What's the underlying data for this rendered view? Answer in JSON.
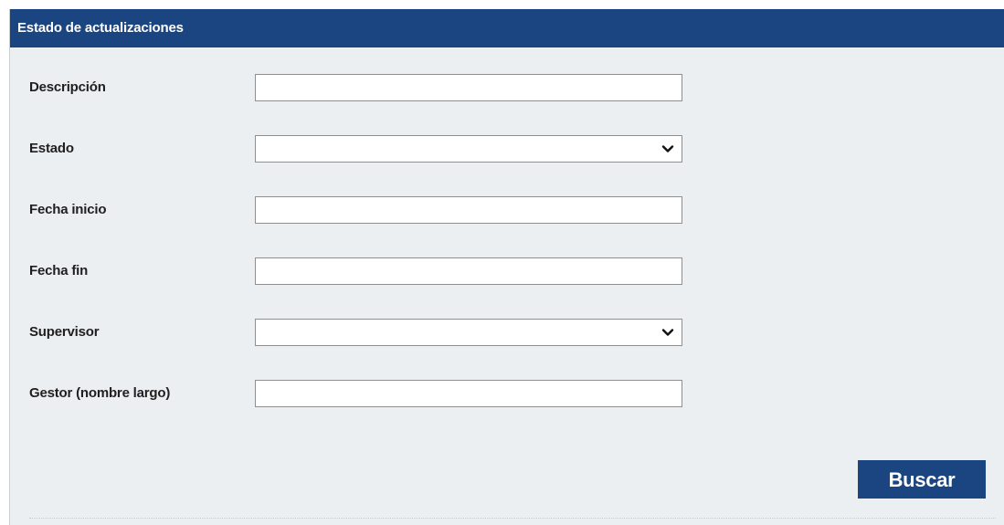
{
  "panel": {
    "title": "Estado de actualizaciones"
  },
  "form": {
    "descripcion": {
      "label": "Descripción",
      "value": "",
      "placeholder": ""
    },
    "estado": {
      "label": "Estado",
      "selected": ""
    },
    "fecha_inicio": {
      "label": "Fecha inicio",
      "value": "",
      "placeholder": ""
    },
    "fecha_fin": {
      "label": "Fecha fin",
      "value": "",
      "placeholder": ""
    },
    "supervisor": {
      "label": "Supervisor",
      "selected": ""
    },
    "gestor": {
      "label": "Gestor (nombre largo)",
      "value": "",
      "placeholder": ""
    }
  },
  "actions": {
    "search_label": "Buscar"
  },
  "icons": {
    "dropdown": "chevron-down-icon"
  },
  "colors": {
    "header_bg": "#1b4580",
    "panel_bg": "#eceff2",
    "button_bg": "#1b4580",
    "header_text": "#ffffff"
  }
}
